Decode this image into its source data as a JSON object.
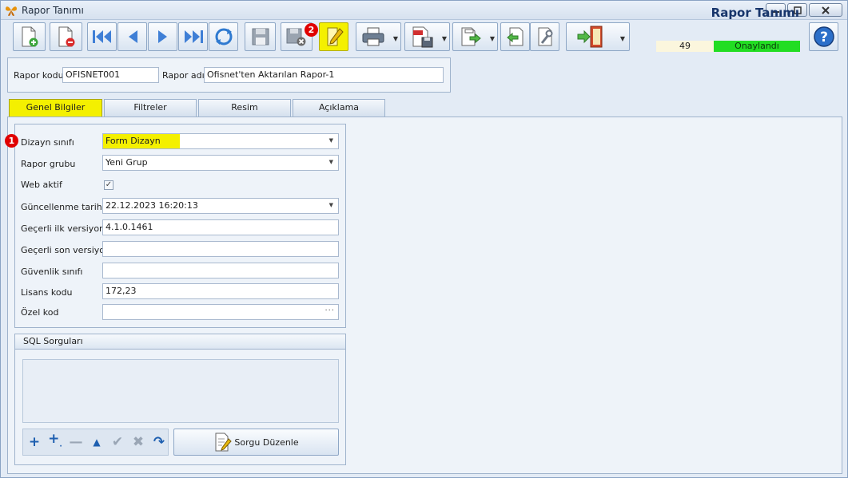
{
  "window": {
    "title": "Rapor Tanımı"
  },
  "header": {
    "title": "Rapor Tanımı",
    "record_count": "49",
    "status": "Onaylandı"
  },
  "annotations": {
    "badge1": "1",
    "badge2": "2"
  },
  "toolbar": {
    "icons": [
      "new-document-icon",
      "delete-document-icon",
      "first-record-icon",
      "previous-record-icon",
      "next-record-icon",
      "last-record-icon",
      "refresh-icon",
      "save-disabled-icon",
      "cancel-save-icon",
      "edit-pencil-icon",
      "print-icon",
      "pdf-export-icon",
      "export-icon",
      "import-icon",
      "settings-wrench-icon",
      "exit-door-icon",
      "help-icon"
    ]
  },
  "fields": {
    "rapor_kodu_label": "Rapor kodu",
    "rapor_kodu_value": "OFISNET001",
    "rapor_adi_label": "Rapor adı",
    "rapor_adi_value": "Ofisnet'ten Aktarılan Rapor-1"
  },
  "tabs": [
    {
      "label": "Genel Bilgiler"
    },
    {
      "label": "Filtreler"
    },
    {
      "label": "Resim"
    },
    {
      "label": "Açıklama"
    }
  ],
  "genel": {
    "dizayn_label": "Dizayn sınıfı",
    "dizayn_value": "Form Dizayn",
    "grup_label": "Rapor grubu",
    "grup_value": "Yeni Grup",
    "web_label": "Web aktif",
    "web_checked": "✓",
    "guncelleme_label": "Güncellenme tarihi",
    "guncelleme_value": "22.12.2023 16:20:13",
    "ilk_label": "Geçerli ilk versiyon",
    "ilk_value": "4.1.0.1461",
    "son_label": "Geçerli son versiyon",
    "son_value": "",
    "guvenlik_label": "Güvenlik sınıfı",
    "guvenlik_value": "",
    "lisans_label": "Lisans kodu",
    "lisans_value": "172,23",
    "ozel_label": "Özel kod",
    "ozel_value": ""
  },
  "sql": {
    "title": "SQL Sorguları",
    "edit_button": "Sorgu Düzenle"
  },
  "colors": {
    "highlight": "#f4f000",
    "status_green": "#22dd22",
    "badge_red": "#e00000",
    "title_blue": "#17356b"
  }
}
